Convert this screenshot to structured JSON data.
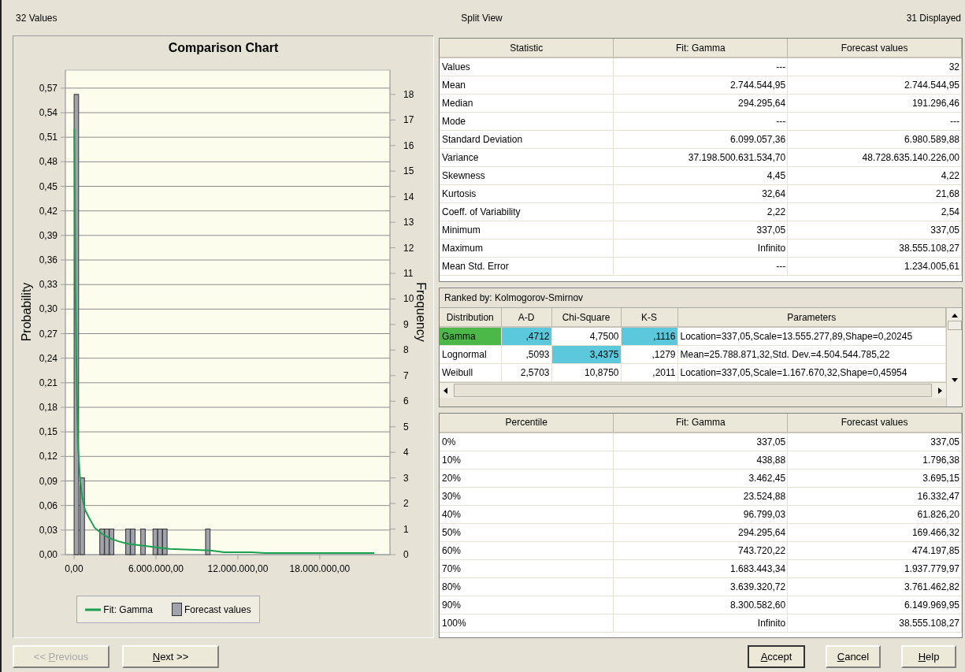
{
  "header": {
    "left": "32 Values",
    "center": "Split View",
    "right": "31 Displayed"
  },
  "chart": {
    "title": "Comparison Chart",
    "chart_data": {
      "type": "bar",
      "ylabel": "Probability",
      "y2label": "Frequency",
      "xticks": [
        {
          "value": 0,
          "label": "0,00"
        },
        {
          "value": 6000000,
          "label": "6.000.000,00"
        },
        {
          "value": 12000000,
          "label": "12.000.000,00"
        },
        {
          "value": 18000000,
          "label": "18.000.000,00"
        }
      ],
      "grid": "y",
      "xlim": [
        -635000,
        23140000
      ],
      "ylim": [
        0,
        0.592
      ],
      "y2lim": [
        0,
        18.95
      ],
      "yticks": [
        {
          "value": 0,
          "label": "0,00"
        },
        {
          "value": 0.03,
          "label": "0,03"
        },
        {
          "value": 0.06,
          "label": "0,06"
        },
        {
          "value": 0.09,
          "label": "0,09"
        },
        {
          "value": 0.12,
          "label": "0,12"
        },
        {
          "value": 0.15,
          "label": "0,15"
        },
        {
          "value": 0.18,
          "label": "0,18"
        },
        {
          "value": 0.21,
          "label": "0,21"
        },
        {
          "value": 0.24,
          "label": "0,24"
        },
        {
          "value": 0.27,
          "label": "0,27"
        },
        {
          "value": 0.3,
          "label": "0,30"
        },
        {
          "value": 0.33,
          "label": "0,33"
        },
        {
          "value": 0.36,
          "label": "0,36"
        },
        {
          "value": 0.39,
          "label": "0,39"
        },
        {
          "value": 0.42,
          "label": "0,42"
        },
        {
          "value": 0.45,
          "label": "0,45"
        },
        {
          "value": 0.48,
          "label": "0,48"
        },
        {
          "value": 0.51,
          "label": "0,51"
        },
        {
          "value": 0.54,
          "label": "0,54"
        },
        {
          "value": 0.57,
          "label": "0,57"
        }
      ],
      "y2ticks": [
        0,
        1,
        2,
        3,
        4,
        5,
        6,
        7,
        8,
        9,
        10,
        11,
        12,
        13,
        14,
        15,
        16,
        17,
        18
      ],
      "series": [
        {
          "name": "Fit: Gamma",
          "color": "#1aa050",
          "type": "line",
          "x": [
            30000,
            100000,
            200000,
            300000,
            450000,
            600000,
            800000,
            1100000,
            1500000,
            2000000,
            2600000,
            3300000,
            4000000,
            5000000,
            6000000,
            7000000,
            8500000,
            10000000,
            11000000,
            13000000,
            14000000,
            16000000,
            19000000,
            22000000
          ],
          "values": [
            0.52,
            0.33,
            0.2,
            0.13,
            0.09,
            0.07,
            0.055,
            0.045,
            0.033,
            0.026,
            0.02,
            0.016,
            0.013,
            0.011,
            0.009,
            0.007,
            0.006,
            0.005,
            0.003,
            0.003,
            0.002,
            0.002,
            0.002,
            0.002
          ]
        },
        {
          "name": "Forecast values",
          "color": "#a0a3ab",
          "type": "bar",
          "axis": "y2",
          "x": [
            170000,
            600000,
            2050000,
            2400000,
            2750000,
            3950000,
            4300000,
            5050000,
            5950000,
            6300000,
            6650000,
            9800000
          ],
          "values": [
            18,
            3,
            1,
            1,
            1,
            1,
            1,
            1,
            1,
            1,
            1,
            1
          ]
        }
      ]
    }
  },
  "statistics": {
    "columns": [
      "Statistic",
      "Fit: Gamma",
      "Forecast values"
    ],
    "rows": [
      [
        "Values",
        "---",
        "32"
      ],
      [
        "Mean",
        "2.744.544,95",
        "2.744.544,95"
      ],
      [
        "Median",
        "294.295,64",
        "191.296,46"
      ],
      [
        "Mode",
        "---",
        "---"
      ],
      [
        "Standard Deviation",
        "6.099.057,36",
        "6.980.589,88"
      ],
      [
        "Variance",
        "37.198.500.631.534,70",
        "48.728.635.140.226,00"
      ],
      [
        "Skewness",
        "4,45",
        "4,22"
      ],
      [
        "Kurtosis",
        "32,64",
        "21,68"
      ],
      [
        "Coeff. of Variability",
        "2,22",
        "2,54"
      ],
      [
        "Minimum",
        "337,05",
        "337,05"
      ],
      [
        "Maximum",
        "Infinito",
        "38.555.108,27"
      ],
      [
        "Mean Std. Error",
        "---",
        "1.234.005,61"
      ]
    ]
  },
  "ranking": {
    "title": "Ranked by: Kolmogorov-Smirnov",
    "columns": [
      "Distribution",
      "A-D",
      "Chi-Square",
      "K-S",
      "Parameters"
    ],
    "rows": [
      {
        "distribution": "Gamma",
        "selected": true,
        "scores": [
          {
            "value": ",4712",
            "best": true
          },
          {
            "value": "4,7500",
            "best": false
          },
          {
            "value": ",1116",
            "best": true
          }
        ],
        "parameters": "Location=337,05,Scale=13.555.277,89,Shape=0,20245"
      },
      {
        "distribution": "Lognormal",
        "selected": false,
        "scores": [
          {
            "value": ",5093",
            "best": false
          },
          {
            "value": "3,4375",
            "best": true
          },
          {
            "value": ",1279",
            "best": false
          }
        ],
        "parameters": "Mean=25.788.871,32,Std. Dev.=4.504.544.785,22"
      },
      {
        "distribution": "Weibull",
        "selected": false,
        "scores": [
          {
            "value": "2,5703",
            "best": false
          },
          {
            "value": "10,8750",
            "best": false
          },
          {
            "value": ",2011",
            "best": false
          }
        ],
        "parameters": "Location=337,05,Scale=1.167.670,32,Shape=0,45954"
      }
    ]
  },
  "percentiles": {
    "columns": [
      "Percentile",
      "Fit: Gamma",
      "Forecast values"
    ],
    "rows": [
      [
        "0%",
        "337,05",
        "337,05"
      ],
      [
        "10%",
        "438,88",
        "1.796,38"
      ],
      [
        "20%",
        "3.462,45",
        "3.695,15"
      ],
      [
        "30%",
        "23.524,88",
        "16.332,47"
      ],
      [
        "40%",
        "96.799,03",
        "61.826,20"
      ],
      [
        "50%",
        "294.295,64",
        "169.466,32"
      ],
      [
        "60%",
        "743.720,22",
        "474.197,85"
      ],
      [
        "70%",
        "1.683.443,34",
        "1.937.779,97"
      ],
      [
        "80%",
        "3.639.320,72",
        "3.761.462,82"
      ],
      [
        "90%",
        "8.300.582,60",
        "6.149.969,95"
      ],
      [
        "100%",
        "Infinito",
        "38.555.108,27"
      ]
    ]
  },
  "buttons_left": [
    {
      "label_before": "<< ",
      "mnemonic": "P",
      "label_after": "revious",
      "disabled": true,
      "default": false
    },
    {
      "mnemonic": "N",
      "label_after": "ext >>",
      "disabled": false,
      "default": false
    }
  ],
  "buttons_right": [
    {
      "mnemonic": "A",
      "label_after": "ccept",
      "disabled": false,
      "default": true
    },
    {
      "mnemonic": "C",
      "label_after": "ancel",
      "disabled": false,
      "default": false
    },
    {
      "mnemonic": "H",
      "label_after": "elp",
      "disabled": false,
      "default": false
    }
  ]
}
